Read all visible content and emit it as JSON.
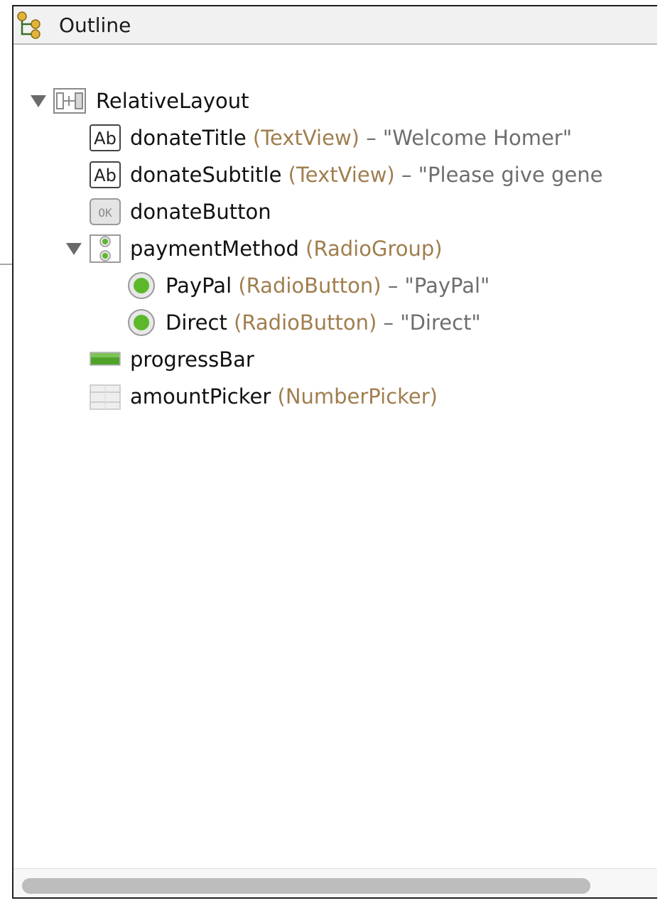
{
  "panel": {
    "title": "Outline",
    "icon": "outline-view-icon"
  },
  "tree": {
    "root": {
      "name": "RelativeLayout",
      "icon": "relative-layout-icon",
      "expanded": true
    },
    "items": [
      {
        "name": "donateTitle",
        "type": "(TextView)",
        "text": " – \"Welcome Homer\"",
        "icon": "textview-icon"
      },
      {
        "name": "donateSubtitle",
        "type": "(TextView)",
        "text": " – \"Please give gene",
        "icon": "textview-icon"
      },
      {
        "name": "donateButton",
        "type": "",
        "text": "",
        "icon": "button-icon"
      },
      {
        "name": "paymentMethod",
        "type": "(RadioGroup)",
        "text": "",
        "icon": "radiogroup-icon",
        "expanded": true
      },
      {
        "name": "PayPal",
        "type": "(RadioButton)",
        "text": " – \"PayPal\"",
        "icon": "radiobutton-icon"
      },
      {
        "name": "Direct",
        "type": "(RadioButton)",
        "text": " – \"Direct\"",
        "icon": "radiobutton-icon"
      },
      {
        "name": "progressBar",
        "type": "",
        "text": "",
        "icon": "progressbar-icon"
      },
      {
        "name": "amountPicker",
        "type": "(NumberPicker)",
        "text": "",
        "icon": "numberpicker-icon"
      }
    ]
  },
  "colors": {
    "type_label": "#a07e4e",
    "text_value": "#6e6e6e",
    "radio_green": "#5cb82a",
    "progress_green": "#4fa32a"
  }
}
